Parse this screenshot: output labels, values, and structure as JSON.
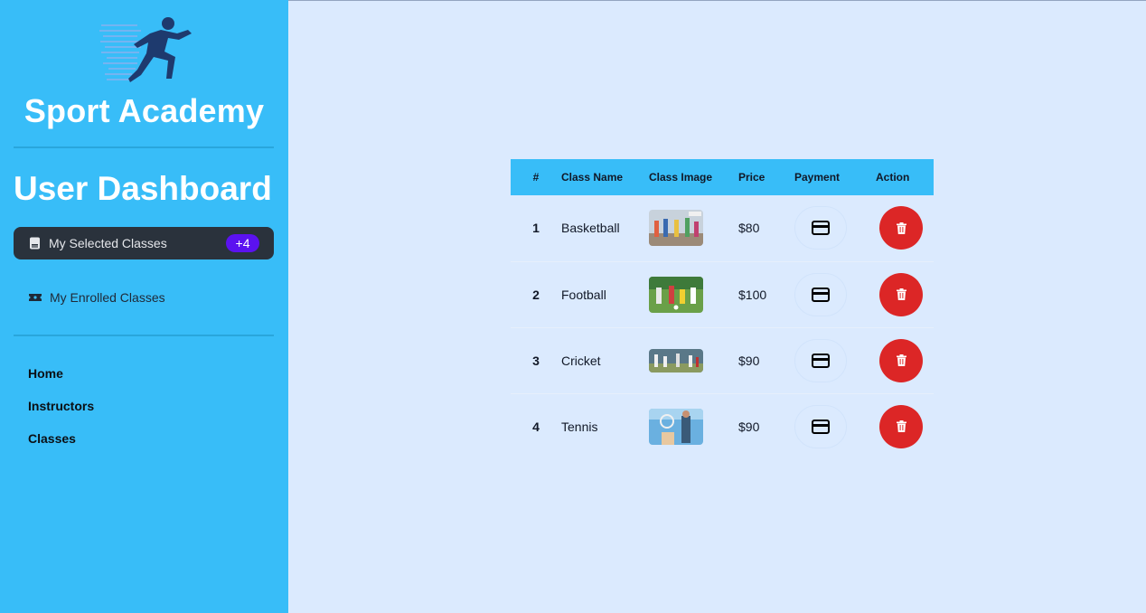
{
  "brand": {
    "name": "Sport Academy",
    "logo_icon": "sprinter-logo-icon"
  },
  "sidebar": {
    "title": "User Dashboard",
    "items": [
      {
        "label": "My Selected Classes",
        "icon": "book-icon",
        "badge": "+4",
        "active": true
      },
      {
        "label": "My Enrolled Classes",
        "icon": "ticket-icon",
        "active": false
      }
    ],
    "links": [
      "Home",
      "Instructors",
      "Classes"
    ]
  },
  "table": {
    "headers": [
      "#",
      "Class Name",
      "Class Image",
      "Price",
      "Payment",
      "Action"
    ],
    "rows": [
      {
        "num": "1",
        "name": "Basketball",
        "image": "basketball-class-image",
        "price": "$80"
      },
      {
        "num": "2",
        "name": "Football",
        "image": "football-class-image",
        "price": "$100"
      },
      {
        "num": "3",
        "name": "Cricket",
        "image": "cricket-class-image",
        "price": "$90"
      },
      {
        "num": "4",
        "name": "Tennis",
        "image": "tennis-class-image",
        "price": "$90"
      }
    ],
    "payment_icon": "credit-card-icon",
    "action_icon": "trash-icon"
  },
  "colors": {
    "sidebar_bg": "#38bdf8",
    "page_bg": "#dbeafe",
    "active_item_bg": "#2a323c",
    "badge_bg": "#5b12f0",
    "delete_bg": "#dc2626"
  }
}
